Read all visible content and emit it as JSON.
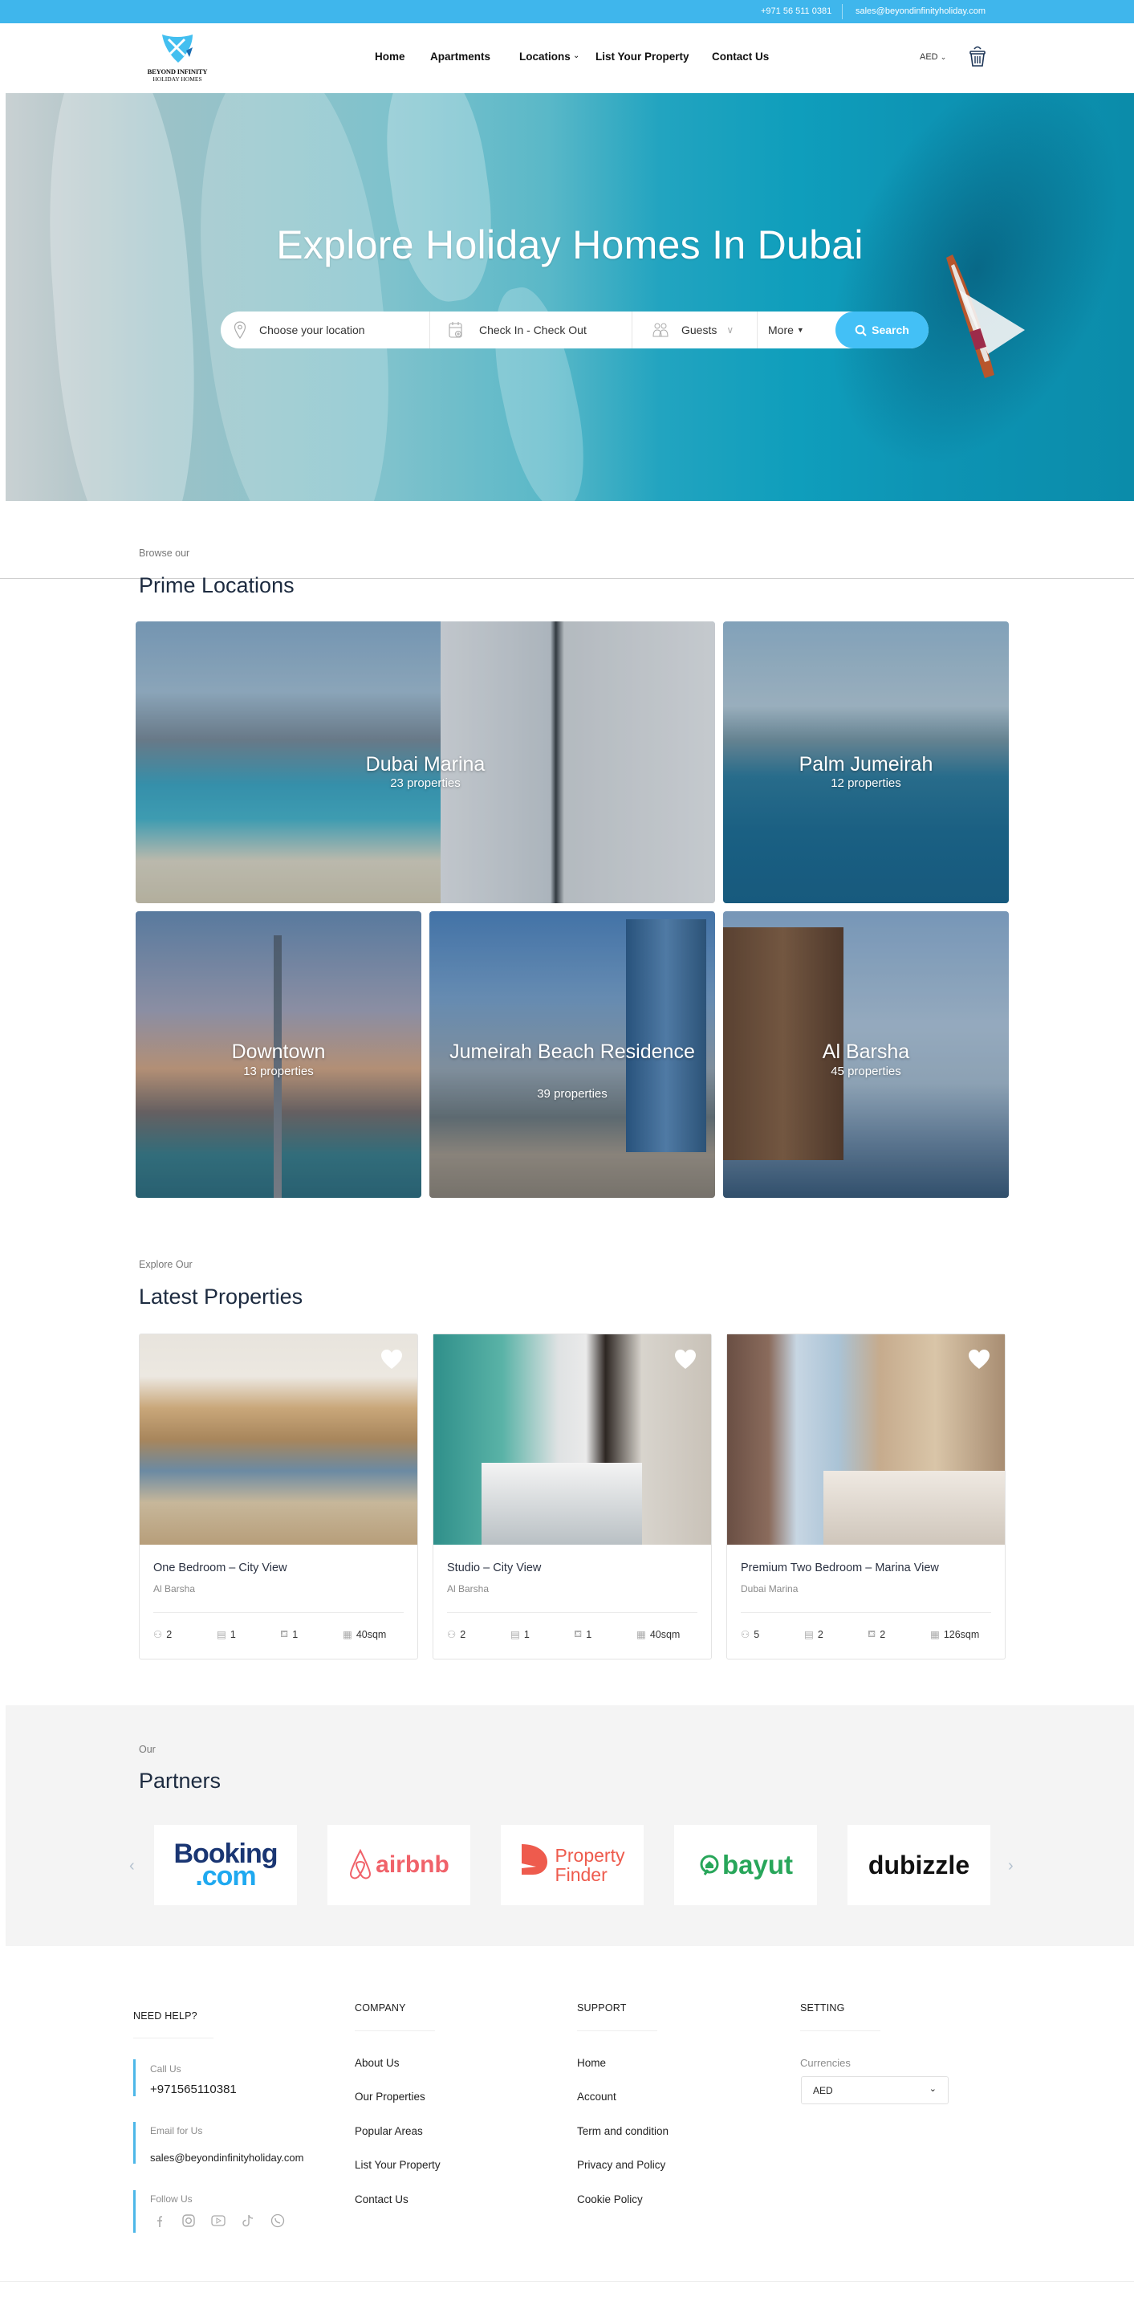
{
  "topbar": {
    "phone": "+971 56 511 0381",
    "email": "sales@beyondinfinityholiday.com"
  },
  "header": {
    "logo_line1": "BEYOND INFINITY",
    "logo_line2": "HOLIDAY HOMES",
    "nav": [
      {
        "label": "Home"
      },
      {
        "label": "Apartments"
      },
      {
        "label": "Locations",
        "has_dropdown": true
      },
      {
        "label": "List Your Property"
      },
      {
        "label": "Contact Us"
      }
    ],
    "currency": "AED",
    "cart_icon": "cart-icon"
  },
  "hero": {
    "title": "Explore Holiday Homes In Dubai",
    "search": {
      "location_placeholder": "Choose your location",
      "dates_placeholder": "Check In - Check Out",
      "guests_label": "Guests",
      "more_label": "More",
      "search_button": "Search"
    }
  },
  "locations": {
    "eyebrow": "Browse our",
    "title": "Prime Locations",
    "items": [
      {
        "name": "Dubai Marina",
        "count": "23 properties"
      },
      {
        "name": "Palm Jumeirah",
        "count": "12 properties"
      },
      {
        "name": "Downtown",
        "count": "13 properties"
      },
      {
        "name": "Jumeirah Beach Residence",
        "count": "39 properties"
      },
      {
        "name": "Al Barsha",
        "count": "45 properties"
      }
    ]
  },
  "properties": {
    "eyebrow": "Explore Our",
    "title": "Latest Properties",
    "items": [
      {
        "title": "One Bedroom – City View",
        "location": "Al Barsha",
        "guests": "2",
        "bedrooms": "1",
        "bathrooms": "1",
        "area": "40sqm"
      },
      {
        "title": "Studio – City View",
        "location": "Al Barsha",
        "guests": "2",
        "bedrooms": "1",
        "bathrooms": "1",
        "area": "40sqm"
      },
      {
        "title": "Premium Two Bedroom – Marina View",
        "location": "Dubai Marina",
        "guests": "5",
        "bedrooms": "2",
        "bathrooms": "2",
        "area": "126sqm"
      }
    ]
  },
  "partners": {
    "eyebrow": "Our",
    "title": "Partners",
    "logos": [
      {
        "name": "Booking.com",
        "line1": "Booking",
        "line2": ".com",
        "color": "#1a3673",
        "accent": "#1fa9f0"
      },
      {
        "name": "airbnb",
        "text": "airbnb",
        "color": "#f0626a"
      },
      {
        "name": "Property Finder",
        "line1": "Property",
        "line2": "Finder",
        "color": "#ee5b4d"
      },
      {
        "name": "bayut",
        "text": "bayut",
        "color": "#28a65a"
      },
      {
        "name": "dubizzle",
        "text": "dubizzle",
        "color": "#111111",
        "accent": "#e1251b"
      }
    ],
    "prev": "‹",
    "next": "›"
  },
  "footer": {
    "need_help": {
      "heading": "NEED HELP?",
      "call_label": "Call Us",
      "call_value": "+971565110381",
      "email_label": "Email for Us",
      "email_value": "sales@beyondinfinityholiday.com",
      "follow_label": "Follow Us",
      "social": [
        "facebook-icon",
        "instagram-icon",
        "youtube-icon",
        "tiktok-icon",
        "whatsapp-icon"
      ]
    },
    "company": {
      "heading": "COMPANY",
      "links": [
        "About Us",
        "Our Properties",
        "Popular Areas",
        "List Your Property",
        "Contact Us"
      ]
    },
    "support": {
      "heading": "SUPPORT",
      "links": [
        "Home",
        "Account",
        "Term and condition",
        "Privacy and Policy",
        "Cookie Policy"
      ]
    },
    "setting": {
      "heading": "SETTING",
      "currencies_label": "Currencies",
      "currency_value": "AED"
    }
  },
  "colors": {
    "accent": "#3fb6ec",
    "search_button": "#43c0f6",
    "heading": "#1d2b40"
  }
}
